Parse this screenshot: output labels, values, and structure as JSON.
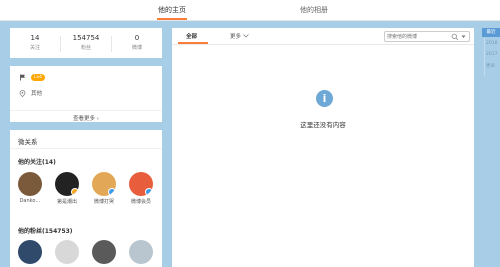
{
  "tabs": [
    {
      "label": "他的主页",
      "active": true
    },
    {
      "label": "他的相册",
      "active": false
    }
  ],
  "stats": [
    {
      "value": "14",
      "label": "关注"
    },
    {
      "value": "154754",
      "label": "粉丝"
    },
    {
      "value": "0",
      "label": "微博"
    }
  ],
  "profile": {
    "level_badge": "Lv4",
    "location": "其他",
    "see_more": "查看更多 ›"
  },
  "relations": {
    "title": "微关系",
    "following_title": "他的关注(14)",
    "following": [
      {
        "name": "Danko…",
        "color": "#7a5a3a"
      },
      {
        "name": "第是潮出",
        "color": "#222222"
      },
      {
        "name": "微博打哭",
        "color": "#e3a857"
      },
      {
        "name": "微博会员",
        "color": "#e85d3b"
      }
    ],
    "followers_title": "他的粉丝(154753)",
    "followers": [
      {
        "name": "",
        "color": "#2f4a6b"
      },
      {
        "name": "",
        "color": "#d8d8d8"
      },
      {
        "name": "",
        "color": "#5a5a5a"
      },
      {
        "name": "",
        "color": "#b9c6cf"
      }
    ]
  },
  "feed": {
    "tabs": [
      {
        "label": "全部",
        "active": true
      },
      {
        "label": "更多",
        "active": false
      }
    ],
    "search_placeholder": "搜索他的微博",
    "empty_text": "这里还没有内容"
  },
  "side_nav": {
    "label": "最近",
    "items": [
      "2018",
      "2017",
      "更早"
    ]
  },
  "colors": {
    "accent": "#fa7d3c",
    "background": "#a8cde6",
    "badge": "#ffa700",
    "info_icon": "#6da8d6"
  }
}
